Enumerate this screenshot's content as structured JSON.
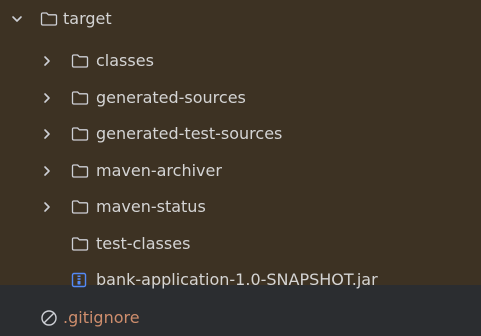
{
  "tree": {
    "root": {
      "label": "target",
      "expanded": true,
      "icon": "folder-icon"
    },
    "items": [
      {
        "label": "classes",
        "icon": "folder-icon",
        "collapsed": true
      },
      {
        "label": "generated-sources",
        "icon": "folder-icon",
        "collapsed": true
      },
      {
        "label": "generated-test-sources",
        "icon": "folder-icon",
        "collapsed": true
      },
      {
        "label": "maven-archiver",
        "icon": "folder-icon",
        "collapsed": true
      },
      {
        "label": "maven-status",
        "icon": "folder-icon",
        "collapsed": true
      },
      {
        "label": "test-classes",
        "icon": "folder-icon",
        "collapsed": false
      },
      {
        "label": "bank-application-1.0-SNAPSHOT.jar",
        "icon": "jar-archive-icon"
      }
    ],
    "gitignore": {
      "label": ".gitignore",
      "icon": "ignored-file-icon"
    }
  },
  "colors": {
    "background": "#2b2d30",
    "excluded_background": "#3d3223",
    "text": "#d4d4d4",
    "ignored_text": "#cf8e6d",
    "icon": "#ced0d6",
    "jar_icon": "#548af7"
  }
}
